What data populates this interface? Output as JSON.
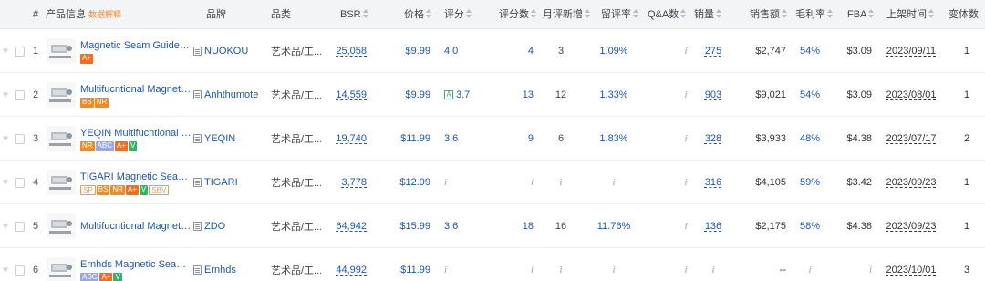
{
  "header": {
    "hash": "#",
    "product_info": "产品信息",
    "data_explain": "数据解释",
    "brand": "品牌",
    "category": "品类",
    "bsr": "BSR",
    "price": "价格",
    "rating": "评分",
    "rating_count": "评分数",
    "monthly_new": "月评新增",
    "retention": "留评率",
    "qa": "Q&A数",
    "sales": "销量",
    "revenue": "销售额",
    "margin": "毛利率",
    "fba": "FBA",
    "listed": "上架时间",
    "variants": "变体数"
  },
  "rows": [
    {
      "idx": "1",
      "title": "Magnetic Seam Guide for...",
      "tags": [
        "A+"
      ],
      "brand": "NUOKOU",
      "category": "艺术品/工...",
      "bsr": "25,058",
      "price": "$9.99",
      "rating": "4.0",
      "rating_count": "4",
      "monthly_new": "3",
      "retention": "1.09%",
      "qa": "i",
      "sales": "275",
      "revenue": "$2,747",
      "margin": "54%",
      "fba": "$3.09",
      "listed": "2023/09/11",
      "variants": "1"
    },
    {
      "idx": "2",
      "title": "Multifucntional Magnetic...",
      "tags": [
        "BS",
        "NR"
      ],
      "brand": "Anhthumote",
      "category": "艺术品/工...",
      "bsr": "14,559",
      "price": "$9.99",
      "rating_badge": "A",
      "rating": "3.7",
      "rating_count": "13",
      "monthly_new": "12",
      "retention": "1.33%",
      "qa": "i",
      "sales": "903",
      "revenue": "$9,021",
      "margin": "54%",
      "fba": "$3.09",
      "listed": "2023/08/01",
      "variants": "1"
    },
    {
      "idx": "3",
      "title": "YEQIN Multifucntional M...",
      "tags": [
        "NR",
        "ABC",
        "A+",
        "V"
      ],
      "brand": "YEQIN",
      "category": "艺术品/工...",
      "bsr": "19,740",
      "price": "$11.99",
      "rating": "3.6",
      "rating_count": "9",
      "monthly_new": "6",
      "retention": "1.83%",
      "qa": "i",
      "sales": "328",
      "revenue": "$3,933",
      "margin": "48%",
      "fba": "$4.38",
      "listed": "2023/07/17",
      "variants": "2"
    },
    {
      "idx": "4",
      "title": "TIGARI Magnetic Seam G...",
      "tags": [
        "SP",
        "BS",
        "NR",
        "A+",
        "V",
        "SBV"
      ],
      "brand": "TIGARI",
      "category": "艺术品/工...",
      "bsr": "3,778",
      "price": "$12.99",
      "rating": "i",
      "rating_count": "i",
      "monthly_new": "i",
      "retention": "i",
      "qa": "i",
      "sales": "316",
      "revenue": "$4,105",
      "margin": "59%",
      "fba": "$3.42",
      "listed": "2023/09/23",
      "variants": "1"
    },
    {
      "idx": "5",
      "title": "Multifucntional Magnetic...",
      "tags": [],
      "brand": "ZDO",
      "category": "艺术品/工...",
      "bsr": "64,942",
      "price": "$15.99",
      "rating": "3.6",
      "rating_count": "18",
      "monthly_new": "16",
      "retention": "11.76%",
      "qa": "i",
      "sales": "136",
      "revenue": "$2,175",
      "margin": "58%",
      "fba": "$4.38",
      "listed": "2023/09/23",
      "variants": "1"
    },
    {
      "idx": "6",
      "title": "Ernhds Magnetic Seam G...",
      "tags": [
        "ABC",
        "A+",
        "V"
      ],
      "brand": "Ernhds",
      "category": "艺术品/工...",
      "bsr": "44,992",
      "price": "$11.99",
      "rating": "i",
      "rating_count": "i",
      "monthly_new": "i",
      "retention": "i",
      "qa": "i",
      "sales": "i",
      "revenue": "--",
      "margin": "i",
      "fba": "i",
      "listed": "2023/10/01",
      "variants": "3"
    }
  ],
  "colors": {
    "link": "#1a56b8",
    "badge_orange": "#f08a24",
    "badge_aplus": "#f56c22",
    "badge_green": "#35b36a",
    "badge_abc": "#9aa7e0",
    "header_bg": "#f3f4f6"
  }
}
